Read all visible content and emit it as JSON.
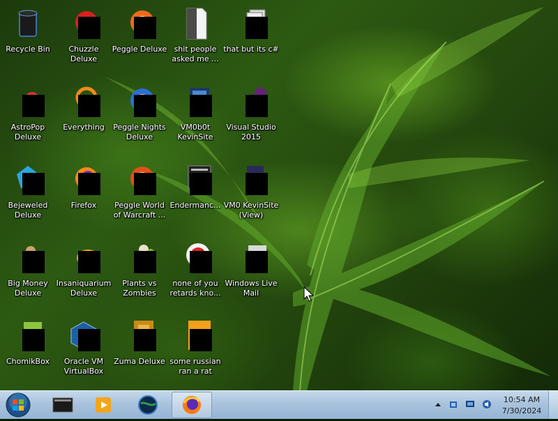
{
  "desktop": {
    "icons": [
      {
        "label": "Recycle Bin",
        "icon": "recycle-bin-icon"
      },
      {
        "label": "Chuzzle\nDeluxe",
        "icon": "chuzzle-icon"
      },
      {
        "label": "Peggle Deluxe",
        "icon": "peggle-icon"
      },
      {
        "label": "shit people\nasked me ...",
        "icon": "document-icon"
      },
      {
        "label": "that but its c#",
        "icon": "document-stack-icon"
      },
      {
        "label": "AstroPop\nDeluxe",
        "icon": "astropop-icon"
      },
      {
        "label": "Everything",
        "icon": "everything-search-icon"
      },
      {
        "label": "Peggle Nights\nDeluxe",
        "icon": "peggle-nights-icon"
      },
      {
        "label": "VM0b0t\nKevinSite",
        "icon": "vm-icon"
      },
      {
        "label": "Visual Studio\n2015",
        "icon": "visual-studio-icon"
      },
      {
        "label": "Bejeweled\nDeluxe",
        "icon": "bejeweled-icon"
      },
      {
        "label": "Firefox",
        "icon": "firefox-icon"
      },
      {
        "label": "Peggle World\nof Warcraft ...",
        "icon": "peggle-wow-icon"
      },
      {
        "label": "Endermanc...",
        "icon": "terminal-icon"
      },
      {
        "label": "VM0 KevinSite\n(View)",
        "icon": "vm-view-icon"
      },
      {
        "label": "Big Money\nDeluxe",
        "icon": "big-money-icon"
      },
      {
        "label": "Insaniquarium\nDeluxe",
        "icon": "insaniquarium-icon"
      },
      {
        "label": "Plants vs\nZombies",
        "icon": "plants-vs-zombies-icon"
      },
      {
        "label": "none of you\nretards kno...",
        "icon": "shortcut-icon"
      },
      {
        "label": "Windows Live\nMail",
        "icon": "windows-live-mail-icon"
      },
      {
        "label": "ChomikBox",
        "icon": "chomikbox-icon"
      },
      {
        "label": "Oracle VM\nVirtualBox",
        "icon": "virtualbox-icon"
      },
      {
        "label": "Zuma Deluxe",
        "icon": "zuma-icon"
      },
      {
        "label": "some russian\nran a rat",
        "icon": "archive-icon"
      }
    ]
  },
  "taskbar": {
    "start_icon": "windows-start-orb-icon",
    "pinned": [
      {
        "name": "terminal-taskbar-icon"
      },
      {
        "name": "media-player-taskbar-icon"
      },
      {
        "name": "globe-taskbar-icon"
      },
      {
        "name": "firefox-taskbar-icon"
      }
    ],
    "tray": {
      "icons": [
        "show-hidden-icons-icon",
        "network-icon",
        "monitor-icon",
        "volume-icon"
      ],
      "time": "10:54 AM",
      "date": "7/30/2024"
    }
  }
}
